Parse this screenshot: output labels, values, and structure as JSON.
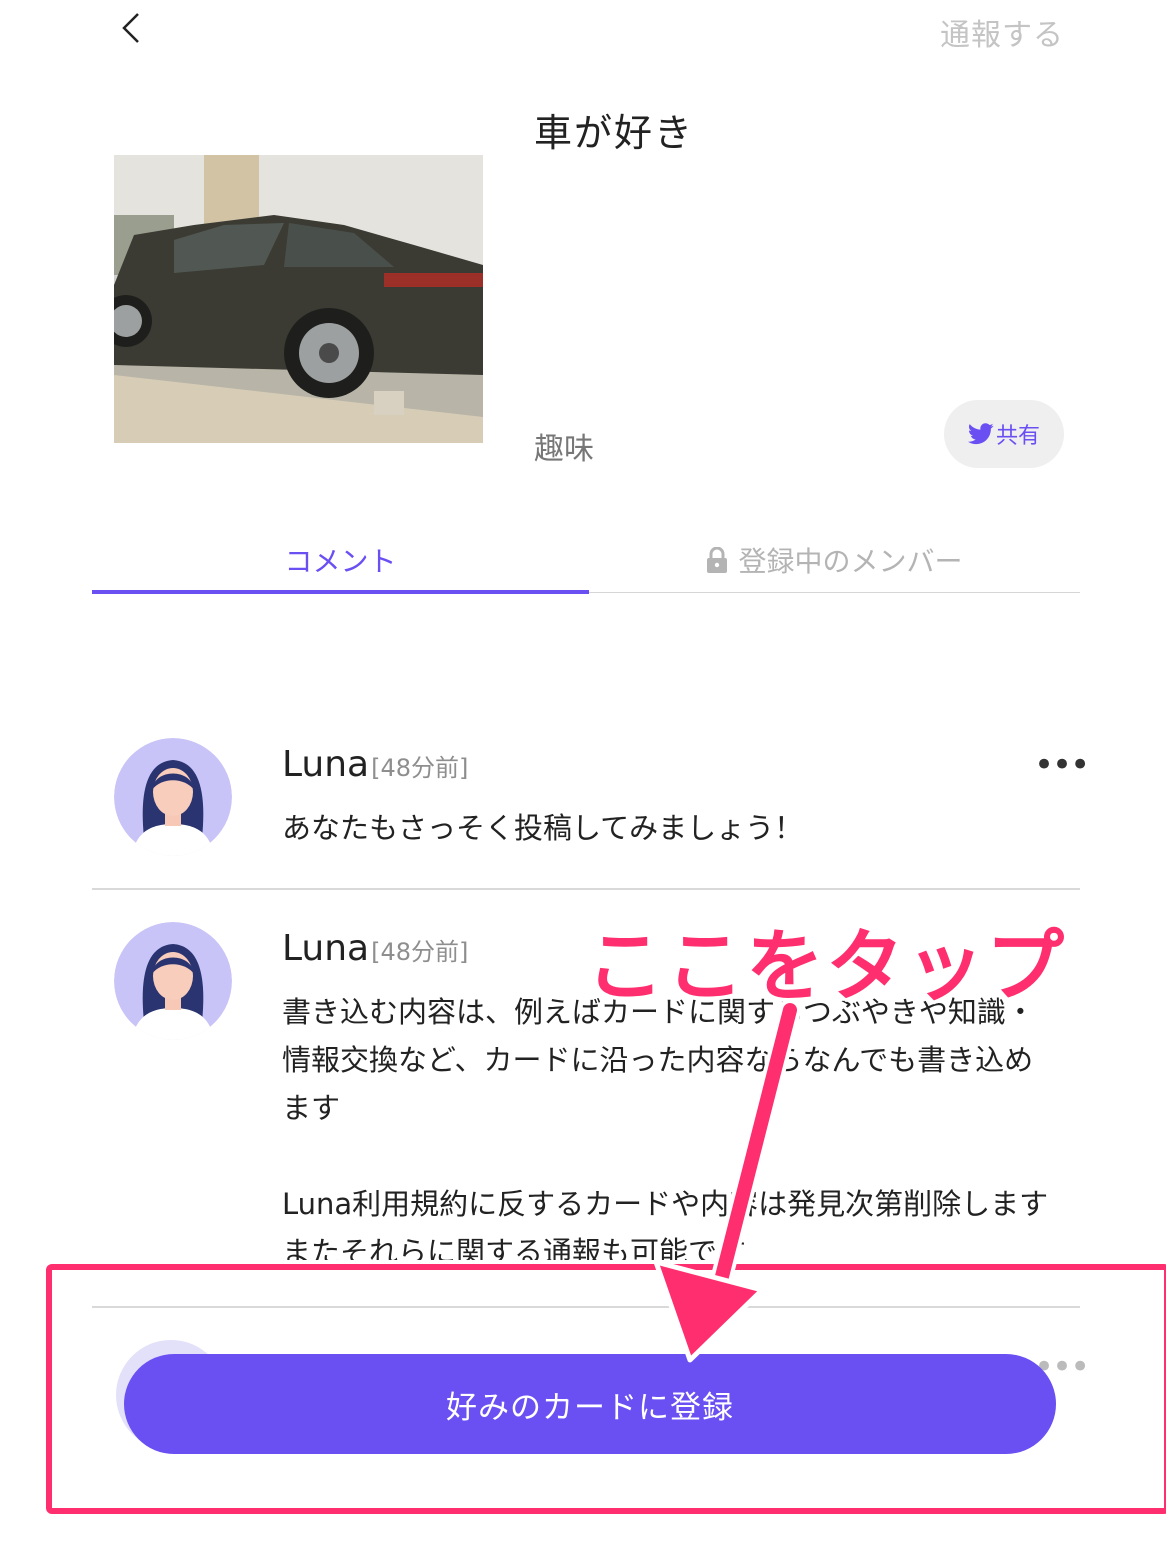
{
  "header": {
    "back_icon": "chevron-left-icon",
    "report_label": "通報する"
  },
  "card": {
    "title": "車が好き",
    "category": "趣味",
    "image_icon": "car-photo",
    "share_label": "共有",
    "share_icon": "twitter-bird-icon"
  },
  "tabs": {
    "comments_label": "コメント",
    "members_label": "登録中のメンバー",
    "members_icon": "lock-icon",
    "active": "comments"
  },
  "comments": [
    {
      "user": "Luna",
      "time": "[48分前]",
      "body": "あなたもさっそく投稿してみましょう！"
    },
    {
      "user": "Luna",
      "time": "[48分前]",
      "body": "書き込む内容は、例えばカードに関するつぶやきや知識・情報交換など、カードに沿った内容ならなんでも書き込めます\n\nLuna利用規約に反するカードや内容は発見次第削除します またそれらに関する通報も可能です"
    }
  ],
  "actions": {
    "register_label": "好みのカードに登録"
  },
  "annotation": {
    "text": "ここをタップ",
    "color": "#ff2e6e"
  },
  "colors": {
    "accent": "#6a4ff3",
    "annotation": "#ff2e6e",
    "avatar_bg": "#c9c4f7"
  }
}
